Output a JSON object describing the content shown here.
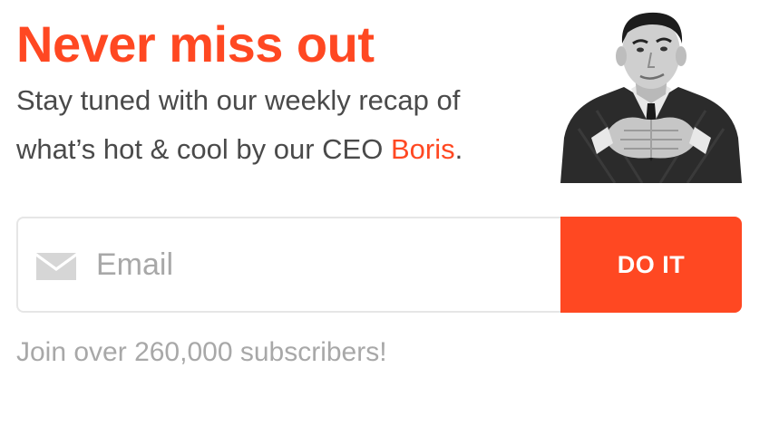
{
  "colors": {
    "accent": "#ff4822",
    "body_text": "#4a4a4a",
    "muted_text": "#a8a8a8",
    "border": "#e6e6e6",
    "button_text": "#ffffff"
  },
  "newsletter": {
    "headline": "Never miss out",
    "tagline_line1": "Stay tuned with our weekly recap of",
    "tagline_line2_prefix": "what’s hot & cool by our CEO ",
    "ceo_name": "Boris",
    "tagline_line2_suffix": ".",
    "portrait_icon": "ceo-portrait-photo"
  },
  "form": {
    "email_icon": "envelope-icon",
    "email_placeholder": "Email",
    "email_value": "",
    "submit_label": "DO IT"
  },
  "footer": {
    "subscribers_text": "Join over 260,000 subscribers!"
  }
}
